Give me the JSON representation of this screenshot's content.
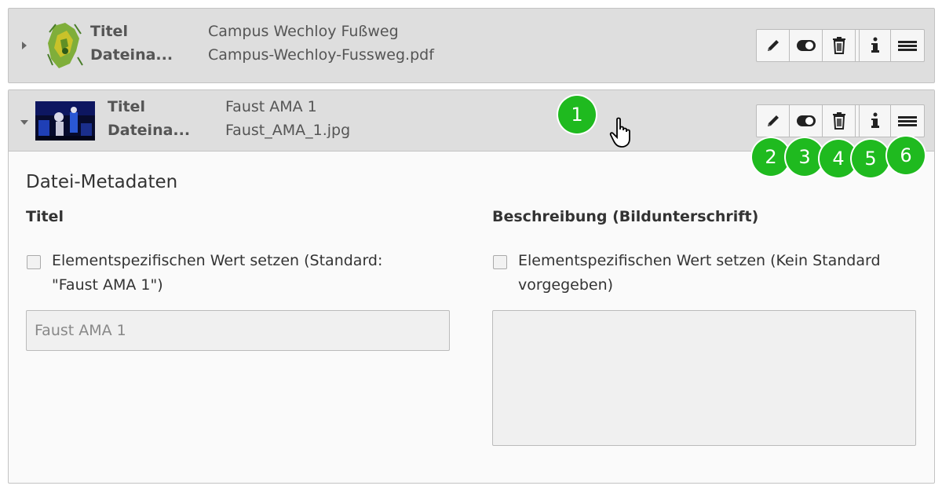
{
  "row1": {
    "label_title": "Titel",
    "label_filename": "Dateina...",
    "title_value": "Campus Wechloy Fußweg",
    "filename_value": "Campus-Wechloy-Fussweg.pdf"
  },
  "row2": {
    "label_title": "Titel",
    "label_filename": "Dateina...",
    "title_value": "Faust AMA 1",
    "filename_value": "Faust_AMA_1.jpg"
  },
  "icons": [
    "pencil-icon",
    "toggle-icon",
    "trash-icon",
    "info-icon",
    "drag-handle-icon"
  ],
  "badges": [
    "1",
    "2",
    "3",
    "4",
    "5",
    "6"
  ],
  "metadata": {
    "section_title": "Datei-Metadaten",
    "title_field": {
      "heading": "Titel",
      "checkbox_label_line1": "Elementspezifischen Wert setzen (Standard:",
      "checkbox_label_line2": "\"Faust AMA 1\")",
      "placeholder": "Faust AMA 1"
    },
    "description_field": {
      "heading": "Beschreibung (Bildunterschrift)",
      "checkbox_label_line1": "Elementspezifischen Wert setzen (Kein Standard",
      "checkbox_label_line2": "vorgegeben)"
    }
  },
  "colors": {
    "badge": "#1fba1f",
    "header_bg": "#dedede"
  }
}
